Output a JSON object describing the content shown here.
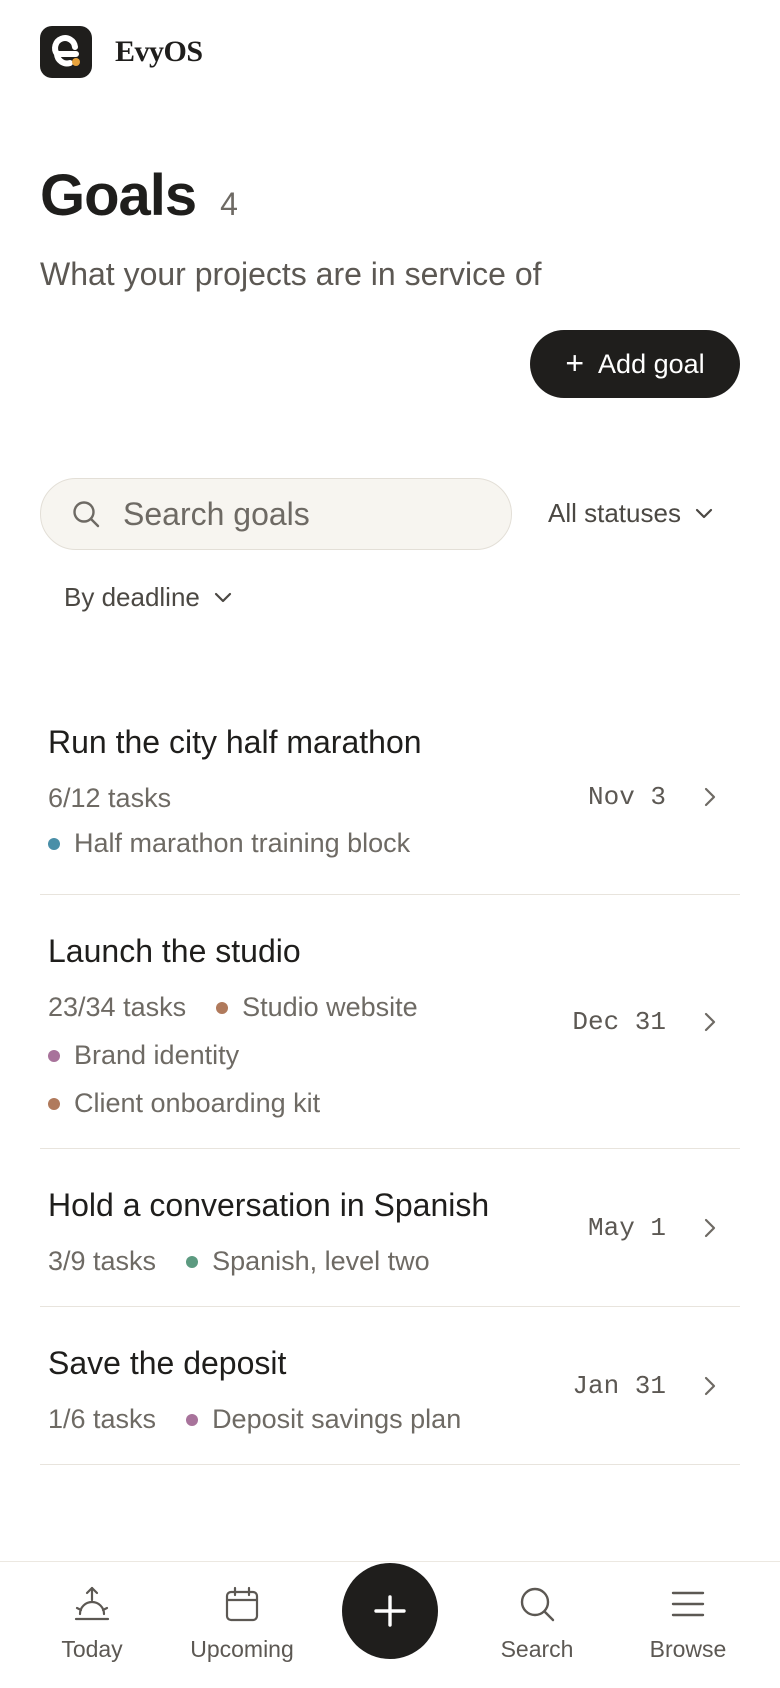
{
  "brand": {
    "name": "EvyOS"
  },
  "header": {
    "title": "Goals",
    "count": "4",
    "subtitle": "What your projects are in service of"
  },
  "actions": {
    "add_goal_label": "Add goal"
  },
  "search": {
    "placeholder": "Search goals"
  },
  "filters": {
    "status_label": "All statuses",
    "sort_label": "By deadline"
  },
  "goals": [
    {
      "title": "Run the city half marathon",
      "tasks": "6/12 tasks",
      "deadline": "Nov 3",
      "projects": [
        {
          "name": "Half marathon training block",
          "color": "#4a8fa8"
        }
      ]
    },
    {
      "title": "Launch the studio",
      "tasks": "23/34 tasks",
      "deadline": "Dec 31",
      "projects": [
        {
          "name": "Studio website",
          "color": "#b07a5c"
        },
        {
          "name": "Brand identity",
          "color": "#a8739b"
        },
        {
          "name": "Client onboarding kit",
          "color": "#b07a5c"
        }
      ]
    },
    {
      "title": "Hold a conversation in Spanish",
      "tasks": "3/9 tasks",
      "deadline": "May 1",
      "projects": [
        {
          "name": "Spanish, level two",
          "color": "#5c9a80"
        }
      ]
    },
    {
      "title": "Save the deposit",
      "tasks": "1/6 tasks",
      "deadline": "Jan 31",
      "projects": [
        {
          "name": "Deposit savings plan",
          "color": "#a8739b"
        }
      ]
    }
  ],
  "nav": {
    "today": "Today",
    "upcoming": "Upcoming",
    "search": "Search",
    "browse": "Browse"
  },
  "colors": {
    "ink": "#1f1e1c",
    "accent": "#e8a33c",
    "muted": "#6e6a64"
  }
}
